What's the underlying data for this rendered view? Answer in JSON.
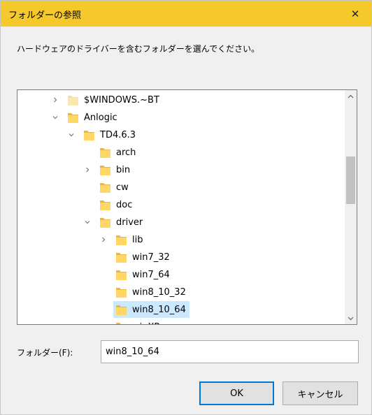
{
  "window": {
    "title": "フォルダーの参照",
    "close_glyph": "✕"
  },
  "instruction": "ハードウェアのドライバーを含むフォルダーを選んでください。",
  "tree": {
    "rows": [
      {
        "label": "$WINDOWS.~BT",
        "level": 0,
        "expander": "collapsed",
        "pale": true
      },
      {
        "label": "Anlogic",
        "level": 0,
        "expander": "expanded"
      },
      {
        "label": "TD4.6.3",
        "level": 1,
        "expander": "expanded"
      },
      {
        "label": "arch",
        "level": 2,
        "expander": "none"
      },
      {
        "label": "bin",
        "level": 2,
        "expander": "collapsed"
      },
      {
        "label": "cw",
        "level": 2,
        "expander": "none"
      },
      {
        "label": "doc",
        "level": 2,
        "expander": "none"
      },
      {
        "label": "driver",
        "level": 2,
        "expander": "expanded"
      },
      {
        "label": "lib",
        "level": 3,
        "expander": "collapsed"
      },
      {
        "label": "win7_32",
        "level": 3,
        "expander": "none"
      },
      {
        "label": "win7_64",
        "level": 3,
        "expander": "none"
      },
      {
        "label": "win8_10_32",
        "level": 3,
        "expander": "none"
      },
      {
        "label": "win8_10_64",
        "level": 3,
        "expander": "none",
        "selected": true
      },
      {
        "label": "winXP",
        "level": 3,
        "expander": "none"
      }
    ]
  },
  "folder_field": {
    "label": "フォルダー(F):",
    "value": "win8_10_64"
  },
  "buttons": {
    "ok": "OK",
    "cancel": "キャンセル"
  },
  "colors": {
    "title_bar": "#f5c92b",
    "selection": "#cce8ff",
    "ok_border": "#0078d7",
    "folder_yellow": "#ffd767"
  }
}
